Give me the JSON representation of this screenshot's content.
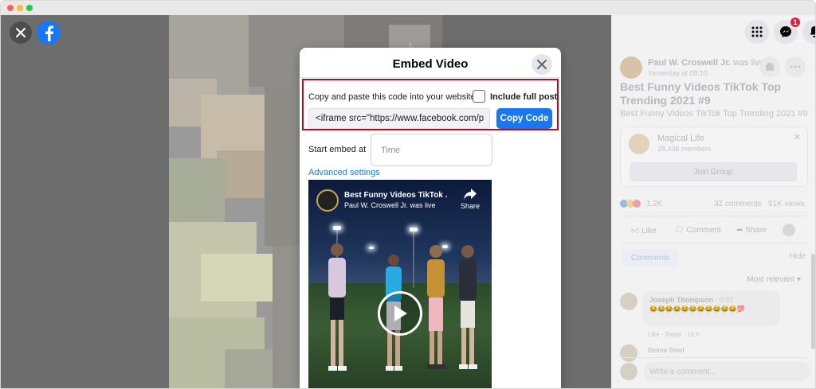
{
  "modal": {
    "title": "Embed Video",
    "copy_label": "Copy and paste this code into your website.",
    "include_full_post_label": "Include full post",
    "include_full_post_checked": false,
    "embed_code": "<iframe src=\"https://www.facebook.com/p",
    "copy_button": "Copy Code",
    "start_embed_label": "Start embed at",
    "time_placeholder": "Time",
    "advanced_settings": "Advanced settings",
    "video": {
      "title": "Best Funny Videos TikTok ...",
      "subtitle": "Paul W. Croswell Jr. was live",
      "share_label": "Share"
    }
  },
  "right_panel": {
    "messenger_badge": "1",
    "author": "Paul W. Croswell Jr.",
    "author_suffix": " was live.",
    "timestamp": "Yesterday at 08:10 · ",
    "post_title": "Best Funny Videos TikTok Top Trending 2021 #9",
    "post_subtitle": "Best Funny Videos TikTok Top Trending 2021 #9",
    "group": {
      "name": "Magical Life",
      "members": "28,436 members",
      "join_button": "Join Group"
    },
    "reactions_count": "1.2K",
    "comments_count": "32 comments",
    "views_count": "91K views",
    "actions": {
      "like": "Like",
      "comment": "Comment",
      "share": "Share"
    },
    "comments_tab": "Comments",
    "hide": "Hide",
    "sort": "Most relevant",
    "comment1": {
      "name": "Joseph Thompson",
      "time": " · 0:37",
      "emoji": "😂😂😂😂😂😂😂😂😂😂😂💯",
      "actions": "Like · Reply · 16 h"
    },
    "comment2_name": "Deime Shed",
    "write_placeholder": "Write a comment..."
  },
  "colors": {
    "facebook_blue": "#1877f2",
    "highlight_red": "#d0021b"
  },
  "icons": [
    "close-icon",
    "facebook-logo-icon",
    "apps-grid-icon",
    "messenger-icon",
    "bell-icon",
    "share-arrow-icon",
    "play-icon",
    "tiktok-icon"
  ]
}
